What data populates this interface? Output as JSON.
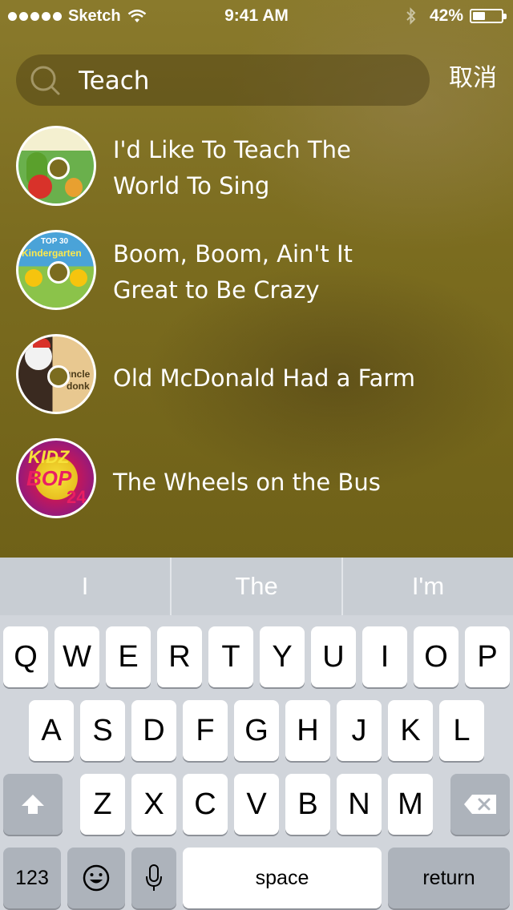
{
  "status_bar": {
    "carrier": "Sketch",
    "time": "9:41 AM",
    "battery": "42%",
    "battery_level": 0.42
  },
  "search": {
    "value": "Teach",
    "cancel_label": "取消"
  },
  "results": [
    {
      "title_line1": "I'd Like To Teach The",
      "title_line2": "World To Sing",
      "art": "veggietales-disc"
    },
    {
      "title_line1": "Boom, Boom, Ain't It",
      "title_line2": "Great to Be Crazy",
      "art": "kindergarten-disc"
    },
    {
      "title_line1": "Old McDonald Had a Farm",
      "title_line2": "",
      "art": "uncle-donkey-disc"
    },
    {
      "title_line1": "The Wheels on the Bus",
      "title_line2": "",
      "art": "kidz-bop-disc"
    }
  ],
  "art_labels": {
    "kidz_bop_line1": "KIDZ",
    "kidz_bop_line2": "BOP",
    "kidz_bop_num": "24",
    "kindergarten_top": "TOP 30",
    "kindergarten": "Kindergarten",
    "uncle": "uncle",
    "donkey": "donk"
  },
  "keyboard": {
    "suggestions": [
      "I",
      "The",
      "I'm"
    ],
    "row1": [
      "Q",
      "W",
      "E",
      "R",
      "T",
      "Y",
      "U",
      "I",
      "O",
      "P"
    ],
    "row2": [
      "A",
      "S",
      "D",
      "F",
      "G",
      "H",
      "J",
      "K",
      "L"
    ],
    "row3": [
      "Z",
      "X",
      "C",
      "V",
      "B",
      "N",
      "M"
    ],
    "numbers_label": "123",
    "space_label": "space",
    "return_label": "return"
  },
  "colors": {
    "background": "#7b6c1f",
    "keyboard_bg": "#d1d5db",
    "text": "#ffffff"
  }
}
